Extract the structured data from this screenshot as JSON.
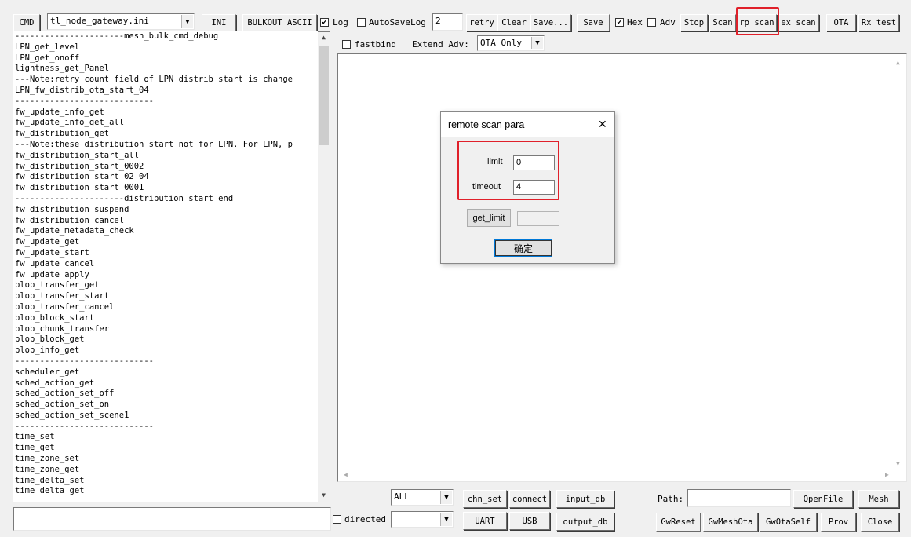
{
  "toolbar": {
    "cmd_label": "CMD",
    "ini_file": "tl_node_gateway.ini",
    "ini_label": "INI",
    "bulkout_label": "BULKOUT ASCII",
    "log_label": "Log",
    "log_checked": true,
    "autosave_label": "AutoSaveLog",
    "autosave_checked": false,
    "retry_value": "2",
    "retry_label": "retry",
    "clear_label": "Clear",
    "save_as_label": "Save...",
    "save_label": "Save",
    "hex_label": "Hex",
    "hex_checked": true,
    "adv_label": "Adv",
    "adv_checked": false,
    "stop_label": "Stop",
    "scan_label": "Scan",
    "rp_scan_label": "rp_scan",
    "ex_scan_label": "ex_scan",
    "ota_label": "OTA",
    "rx_test_label": "Rx test"
  },
  "options_row": {
    "fastbind_label": "fastbind",
    "fastbind_checked": false,
    "extend_adv_label": "Extend Adv:",
    "extend_adv_value": "OTA Only"
  },
  "command_list": [
    "----------------------mesh_bulk_cmd_debug",
    "LPN_get_level",
    "LPN_get_onoff",
    "lightness_get_Panel",
    "---Note:retry count field of LPN distrib start is change",
    "LPN_fw_distrib_ota_start_04",
    "----------------------------",
    "fw_update_info_get",
    "fw_update_info_get_all",
    "fw_distribution_get",
    "---Note:these distribution start not for LPN. For LPN, p",
    "fw_distribution_start_all",
    "fw_distribution_start_0002",
    "fw_distribution_start_02_04",
    "fw_distribution_start_0001",
    "----------------------distribution start end",
    "fw_distribution_suspend",
    "fw_distribution_cancel",
    "fw_update_metadata_check",
    "fw_update_get",
    "fw_update_start",
    "fw_update_cancel",
    "fw_update_apply",
    "blob_transfer_get",
    "blob_transfer_start",
    "blob_transfer_cancel",
    "blob_block_start",
    "blob_chunk_transfer",
    "blob_block_get",
    "blob_info_get",
    "----------------------------",
    "scheduler_get",
    "sched_action_get",
    "sched_action_set_off",
    "sched_action_set_on",
    "sched_action_set_scene1",
    "----------------------------",
    "time_set",
    "time_get",
    "time_zone_set",
    "time_zone_get",
    "time_delta_set",
    "time_delta_get"
  ],
  "bottom": {
    "directed_label": "directed",
    "directed_checked": false,
    "channel_value": "ALL",
    "chn_set_label": "chn_set",
    "connect_label": "connect",
    "input_db_label": "input_db",
    "uart_label": "UART",
    "usb_label": "USB",
    "output_db_label": "output_db",
    "path_label": "Path:",
    "path_value": "",
    "openfile_label": "OpenFile",
    "mesh_label": "Mesh",
    "gwreset_label": "GwReset",
    "gwmeshota_label": "GwMeshOta",
    "gwotaself_label": "GwOtaSelf",
    "prov_label": "Prov",
    "close_label": "Close"
  },
  "dialog": {
    "title": "remote scan para",
    "close_glyph": "✕",
    "limit_label": "limit",
    "limit_value": "0",
    "timeout_label": "timeout",
    "timeout_value": "4",
    "get_limit_label": "get_limit",
    "get_limit_value": "",
    "ok_label": "确定"
  },
  "icons": {
    "dropdown": "▼",
    "check": "✔",
    "scroll_up": "▲",
    "scroll_down": "▼",
    "scroll_left": "◀",
    "scroll_right": "▶"
  },
  "colors": {
    "highlight": "#e0202a",
    "window_bg": "#f0f0f0"
  }
}
